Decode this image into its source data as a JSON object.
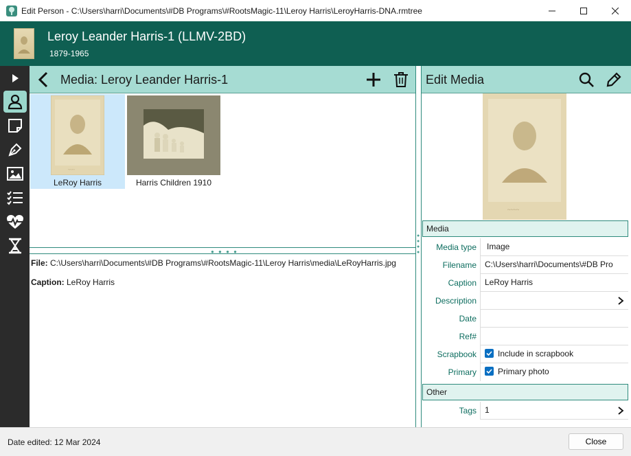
{
  "window": {
    "title": "Edit Person - C:\\Users\\harri\\Documents\\#DB Programs\\#RootsMagic-11\\Leroy Harris\\LeroyHarris-DNA.rmtree"
  },
  "person": {
    "name": "Leroy Leander Harris-1 (LLMV-2BD)",
    "dates": "1879-1965"
  },
  "media_pane": {
    "title": "Media: Leroy Leander Harris-1",
    "items": [
      {
        "caption": "LeRoy Harris",
        "selected": true
      },
      {
        "caption": "Harris Children 1910",
        "selected": false
      }
    ],
    "file_label": "File:",
    "file_value": "C:\\Users\\harri\\Documents\\#DB Programs\\#RootsMagic-11\\Leroy Harris\\media\\LeRoyHarris.jpg",
    "caption_label": "Caption:",
    "caption_value": "LeRoy Harris"
  },
  "edit_media": {
    "title": "Edit Media",
    "section_media": "Media",
    "section_other": "Other",
    "fields": {
      "media_type_label": "Media type",
      "media_type_value": "Image",
      "filename_label": "Filename",
      "filename_value": "C:\\Users\\harri\\Documents\\#DB Pro",
      "caption_label": "Caption",
      "caption_value": "LeRoy Harris",
      "description_label": "Description",
      "description_value": "",
      "date_label": "Date",
      "date_value": "",
      "ref_label": "Ref#",
      "ref_value": "",
      "scrapbook_label": "Scrapbook",
      "scrapbook_value": "Include in scrapbook",
      "scrapbook_checked": true,
      "primary_label": "Primary",
      "primary_value": "Primary photo",
      "primary_checked": true,
      "tags_label": "Tags",
      "tags_value": "1"
    }
  },
  "status": {
    "date_edited": "Date edited: 12 Mar 2024",
    "close_label": "Close"
  },
  "colors": {
    "header_bg": "#0f5f52",
    "pane_header_bg": "#a6dcd3",
    "accent": "#2e8a7c",
    "sidebar_bg": "#2b2b2b",
    "selected_bg": "#cce8fb",
    "checkbox": "#0a6fc2"
  },
  "icons": {
    "app": "family-tree-icon",
    "sidebar": [
      "expand-arrow-icon",
      "person-icon",
      "note-icon",
      "pen-nib-icon",
      "image-icon",
      "checklist-icon",
      "health-heart-icon",
      "hourglass-icon"
    ],
    "toolbar": [
      "back-arrow-icon",
      "add-icon",
      "trash-icon",
      "search-icon",
      "pencil-icon"
    ]
  }
}
